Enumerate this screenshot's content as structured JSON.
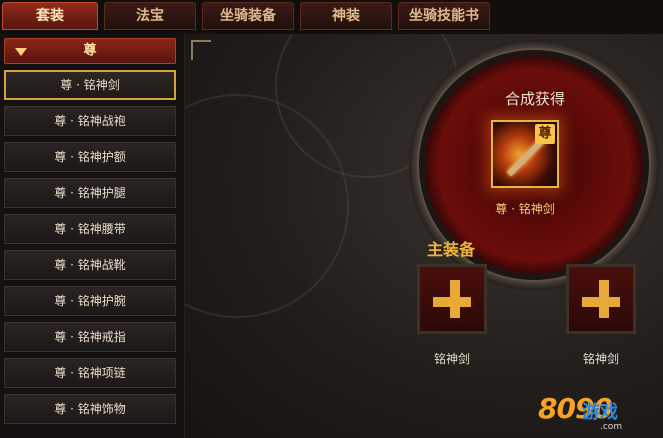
{
  "tabs": [
    "套装",
    "法宝",
    "坐骑装备",
    "神装",
    "坐骑技能书"
  ],
  "sidebar": {
    "category": "尊",
    "items": [
      "尊 · 铭神剑",
      "尊 · 铭神战袍",
      "尊 · 铭神护额",
      "尊 · 铭神护腿",
      "尊 · 铭神腰带",
      "尊 · 铭神战靴",
      "尊 · 铭神护腕",
      "尊 · 铭神戒指",
      "尊 · 铭神项链",
      "尊 · 铭神饰物"
    ]
  },
  "synthesis": {
    "title": "合成获得",
    "result_badge": "尊",
    "result_name": "尊 · 铭神剑"
  },
  "main_equip": {
    "label": "主装备",
    "slots": [
      "铭神剑",
      "铭神剑"
    ]
  },
  "watermark": {
    "logo": "8090",
    "site": "游戏",
    "url": ".com"
  },
  "colors": {
    "accent_gold": "#e4b648",
    "tab_active": "#8f2a1b",
    "slot_plus": "#e8a937"
  }
}
